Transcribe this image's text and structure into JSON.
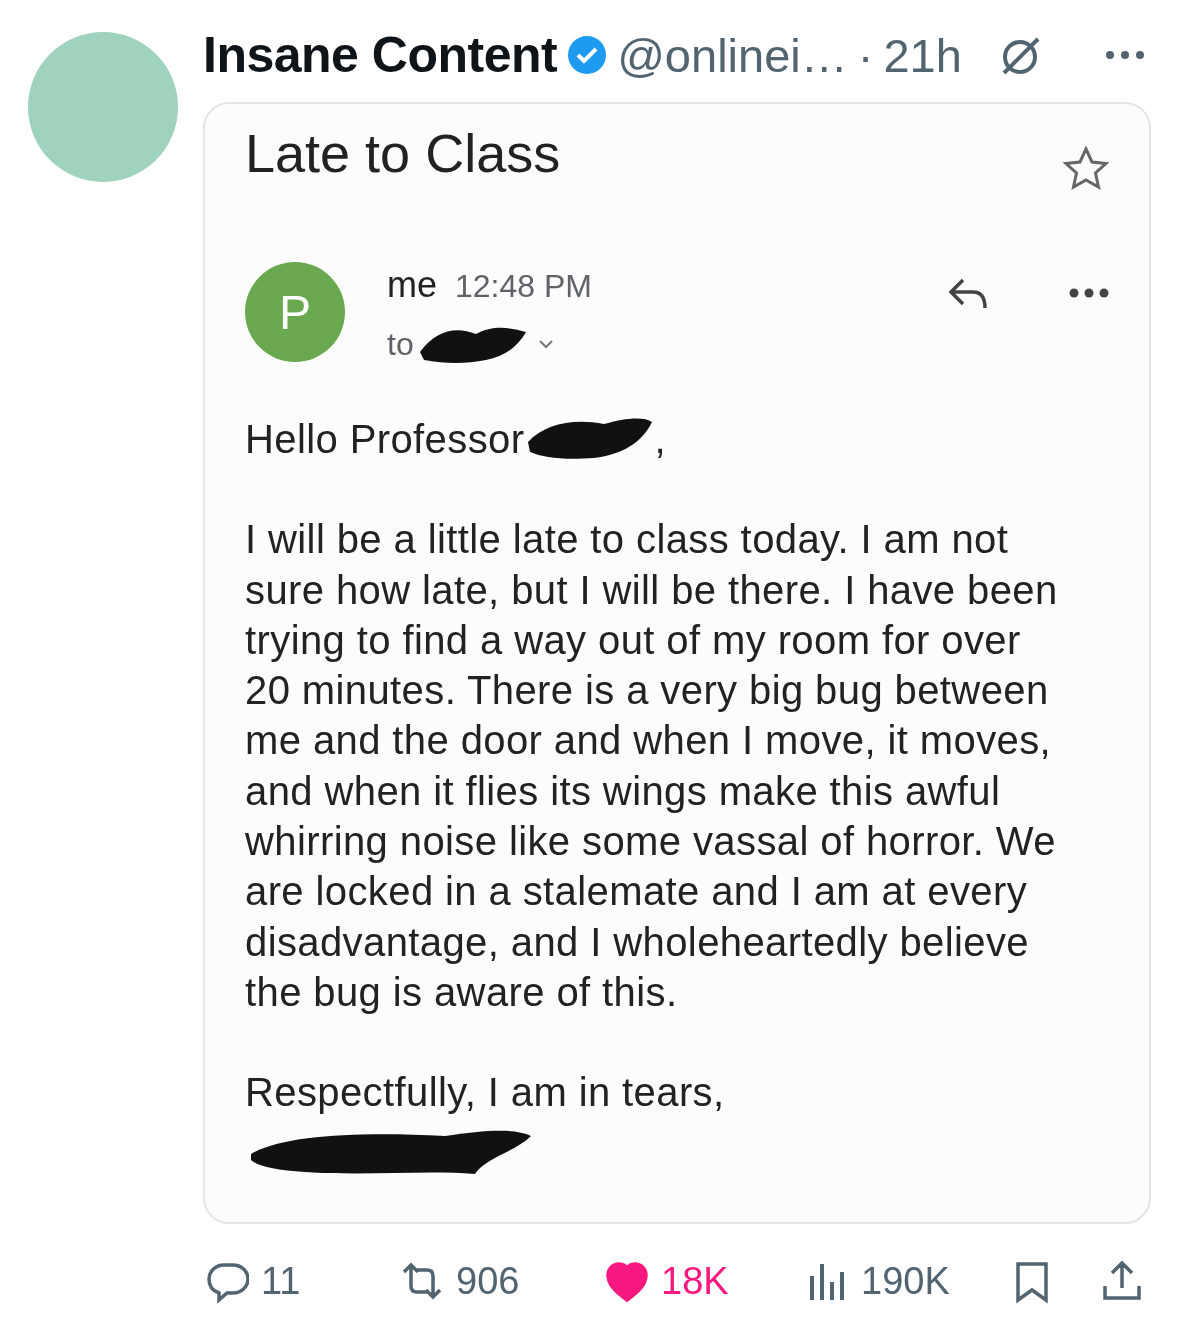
{
  "author": {
    "name": "Insane Content",
    "verified": true,
    "handle": "@onlinei…",
    "separator": "·",
    "time": "21h"
  },
  "email": {
    "subject": "Late to Class",
    "starred": false,
    "sender_initial": "P",
    "sender": "me",
    "time": "12:48 PM",
    "to_label": "to",
    "greeting": "Hello Professor",
    "greeting_end": ",",
    "body": "I will be a little late to class today. I am not\nsure how late, but I will be there. I have been\ntrying to find a way out of my room for over\n20 minutes. There is a very big bug between\nme and the door and when I move, it moves,\nand when it flies its wings make this awful\nwhirring noise like some vassal of horror. We\nare locked in a stalemate and I am at every\ndisadvantage, and I wholeheartedly believe\nthe bug is aware of this.",
    "closing": "Respectfully, I am in tears,"
  },
  "actions": [
    {
      "kind": "reply",
      "count": "11",
      "active": false
    },
    {
      "kind": "repost",
      "count": "906",
      "active": false
    },
    {
      "kind": "like",
      "count": "18K",
      "active": true
    },
    {
      "kind": "views",
      "count": "190K",
      "active": false
    },
    {
      "kind": "bookmark",
      "active": false
    },
    {
      "kind": "share",
      "active": false
    }
  ]
}
